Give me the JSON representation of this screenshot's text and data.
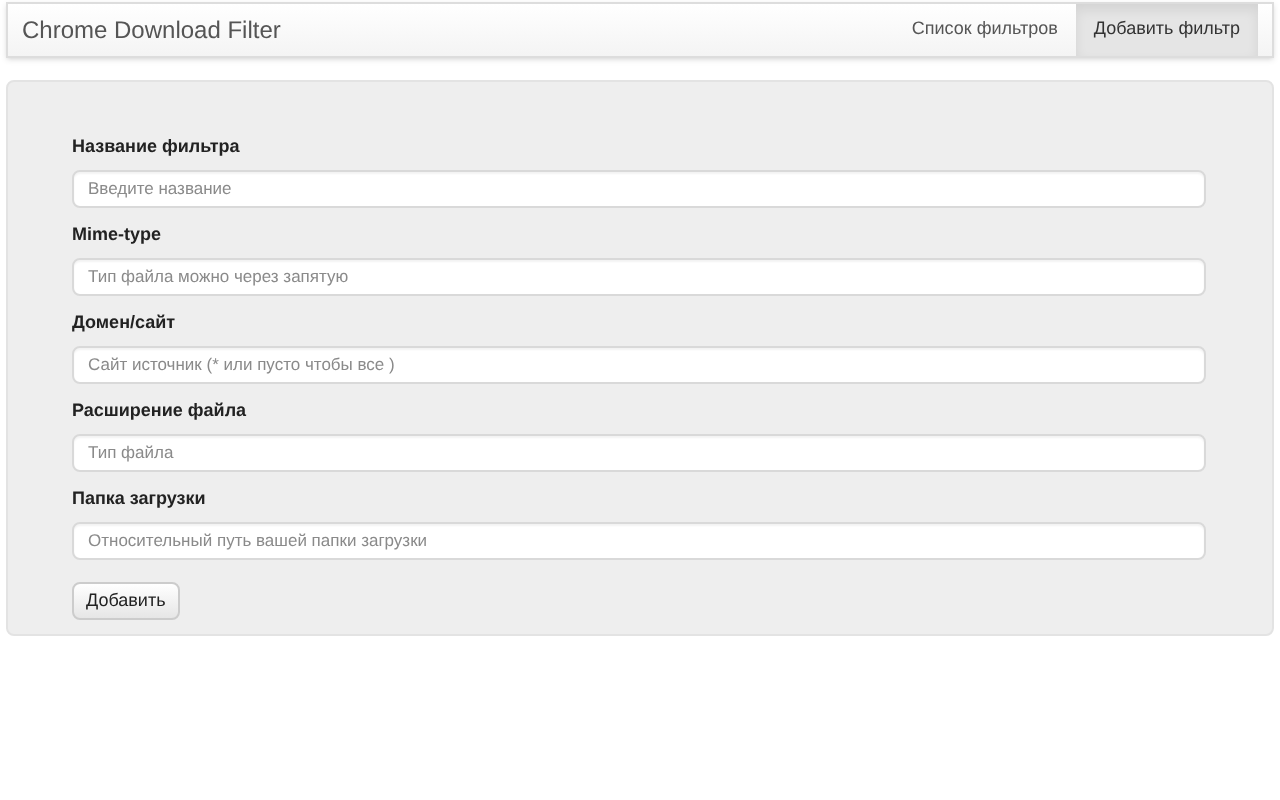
{
  "navbar": {
    "brand": "Chrome Download Filter",
    "tabs": [
      {
        "label": "Список фильтров",
        "selected": false
      },
      {
        "label": "Добавить фильтр",
        "selected": true
      }
    ]
  },
  "form": {
    "fields": [
      {
        "label": "Название фильтра",
        "placeholder": "Введите название"
      },
      {
        "label": "Mime-type",
        "placeholder": "Тип файла можно через запятую"
      },
      {
        "label": "Домен/сайт",
        "placeholder": "Сайт источник (* или пусто чтобы все )"
      },
      {
        "label": "Расширение файла",
        "placeholder": "Тип файла"
      },
      {
        "label": "Папка загрузки",
        "placeholder": "Относительный путь вашей папки загрузки"
      }
    ],
    "submit": "Добавить"
  }
}
